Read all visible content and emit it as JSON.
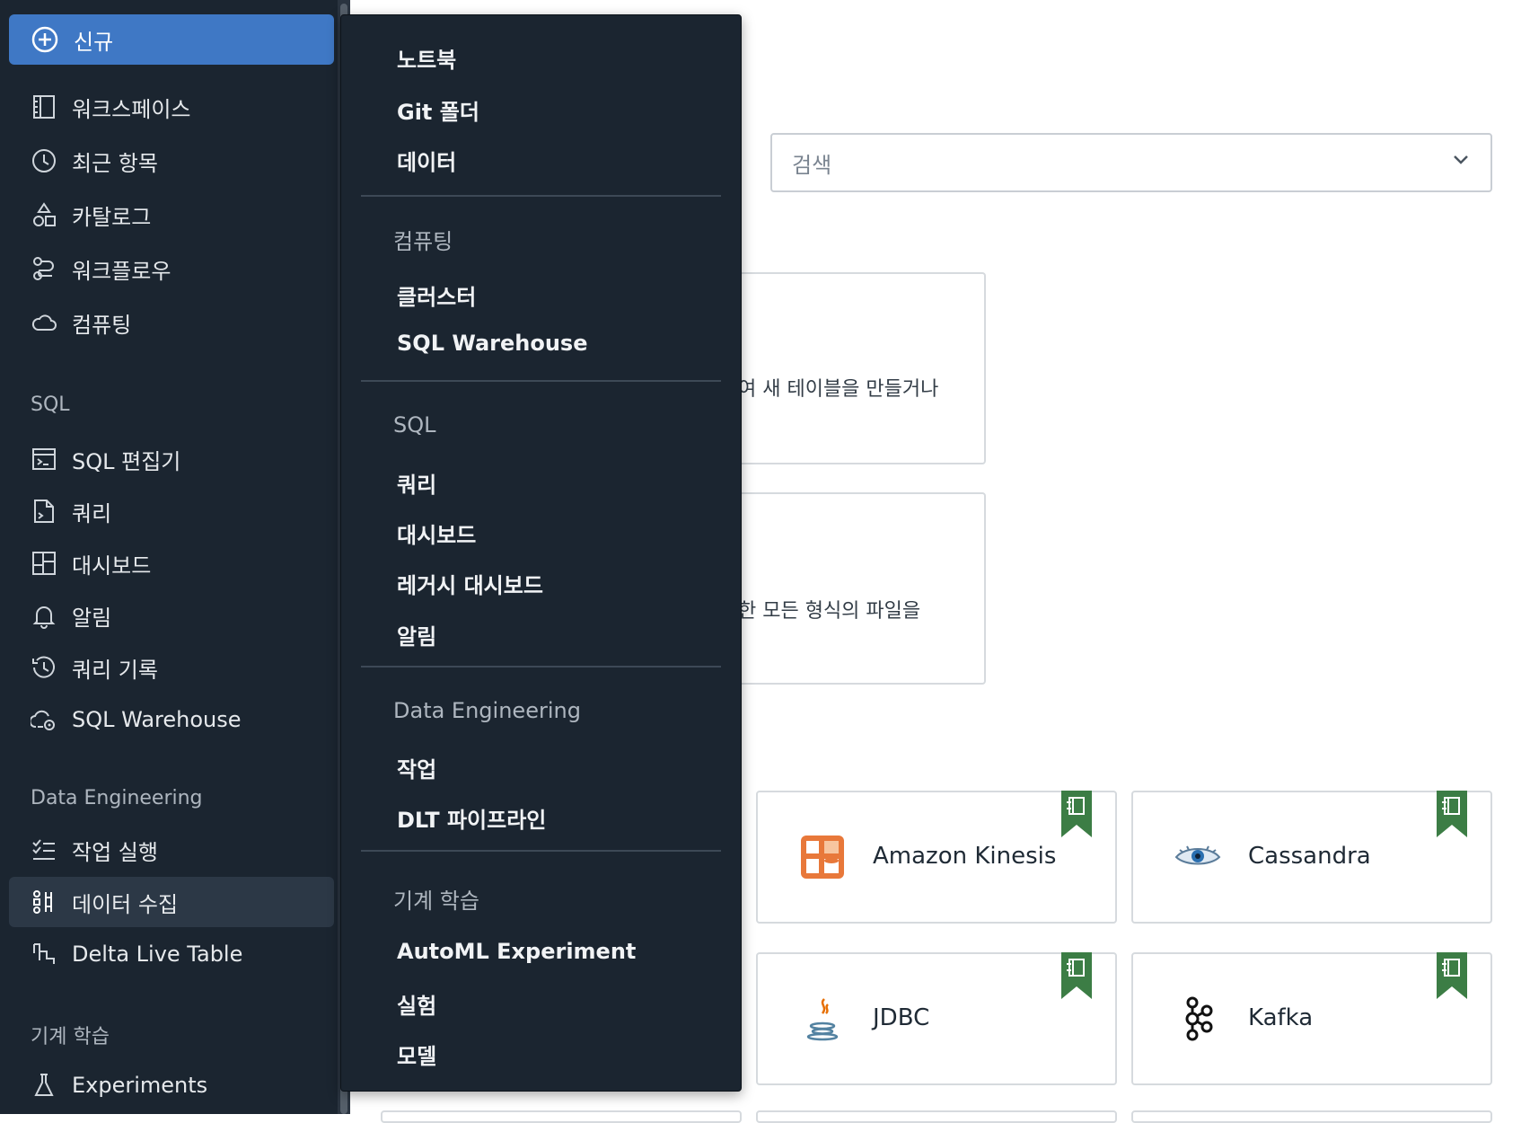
{
  "sidebar": {
    "new_label": "신규",
    "items_top": [
      {
        "label": "워크스페이스",
        "icon": "workspace-icon"
      },
      {
        "label": "최근 항목",
        "icon": "clock-icon"
      },
      {
        "label": "카탈로그",
        "icon": "catalog-icon"
      },
      {
        "label": "워크플로우",
        "icon": "workflow-icon"
      },
      {
        "label": "컴퓨팅",
        "icon": "cloud-icon"
      }
    ],
    "sql_section": "SQL",
    "items_sql": [
      {
        "label": "SQL 편집기",
        "icon": "sql-editor-icon"
      },
      {
        "label": "쿼리",
        "icon": "query-icon"
      },
      {
        "label": "대시보드",
        "icon": "dashboard-icon"
      },
      {
        "label": "알림",
        "icon": "bell-icon"
      },
      {
        "label": "쿼리 기록",
        "icon": "history-icon"
      },
      {
        "label": "SQL Warehouse",
        "icon": "warehouse-icon"
      }
    ],
    "de_section": "Data Engineering",
    "items_de": [
      {
        "label": "작업 실행",
        "icon": "job-runs-icon"
      },
      {
        "label": "데이터 수집",
        "icon": "data-ingest-icon",
        "active": true
      },
      {
        "label": "Delta Live Table",
        "icon": "delta-live-icon"
      }
    ],
    "ml_section": "기계 학습",
    "items_ml": [
      {
        "label": "Experiments",
        "icon": "flask-icon"
      }
    ]
  },
  "menu": {
    "group1": [
      "노트북",
      "Git 폴더",
      "데이터"
    ],
    "compute_header": "컴퓨팅",
    "compute_items": [
      "클러스터",
      "SQL Warehouse"
    ],
    "sql_header": "SQL",
    "sql_items": [
      "쿼리",
      "대시보드",
      "레거시 대시보드",
      "알림"
    ],
    "de_header": "Data Engineering",
    "de_items": [
      "작업",
      "DLT 파이프라인"
    ],
    "ml_header": "기계 학습",
    "ml_items": [
      "AutoML Experiment",
      "실험",
      "모델"
    ]
  },
  "main": {
    "search_placeholder": "검색",
    "card1_text": "여 새 테이블을 만들거나",
    "card2_text": "한 모든 형식의 파일을",
    "sources": [
      {
        "label": "Amazon Kinesis",
        "icon": "kinesis-icon"
      },
      {
        "label": "Cassandra",
        "icon": "cassandra-eye-icon"
      },
      {
        "label": "JDBC",
        "icon": "java-icon"
      },
      {
        "label": "Kafka",
        "icon": "kafka-icon"
      }
    ]
  },
  "colors": {
    "sidebar_bg": "#1b2530",
    "accent_blue": "#3f78c5",
    "ribbon_green": "#3c7d45"
  }
}
